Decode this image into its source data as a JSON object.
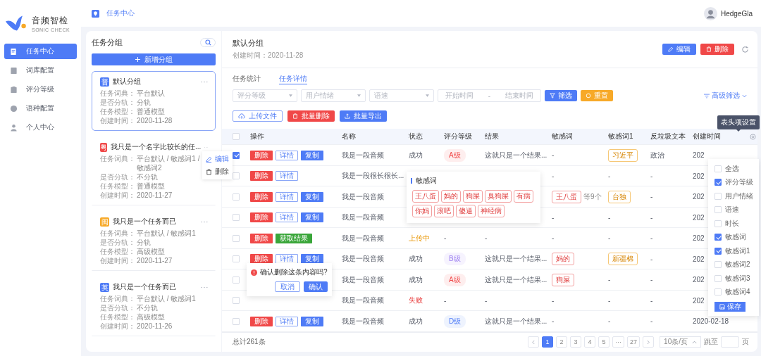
{
  "sidebar": {
    "logo": {
      "name": "音频智检",
      "subtitle": "SONIC CHECK"
    },
    "items": [
      {
        "label": "任务中心",
        "selected": true
      },
      {
        "label": "词库配置",
        "selected": false
      },
      {
        "label": "评分等级",
        "selected": false
      },
      {
        "label": "语种配置",
        "selected": false
      },
      {
        "label": "个人中心",
        "selected": false
      }
    ]
  },
  "topbar": {
    "breadcrumb": "任务中心",
    "user": "HedgeGla"
  },
  "groups": {
    "title": "任务分组",
    "add_button": "新增分组",
    "items": [
      {
        "badge": "普",
        "color": "#4e7bf6",
        "title": "默认分组",
        "selected": true,
        "fields": [
          {
            "label": "任务词典：",
            "value": "平台默认"
          },
          {
            "label": "是否分轨：",
            "value": "分轨"
          },
          {
            "label": "任务模型：",
            "value": "普通模型"
          },
          {
            "label": "创建时间：",
            "value": "2020-11-28"
          }
        ]
      },
      {
        "badge": "粤",
        "color": "#f04848",
        "title": "我只是一个名字比较长的任...",
        "selected": false,
        "fields": [
          {
            "label": "任务词典：",
            "value": "平台默认 / 敏感词1 / 敏感词2"
          },
          {
            "label": "是否分轨：",
            "value": "不分轨"
          },
          {
            "label": "任务模型：",
            "value": "普通模型"
          },
          {
            "label": "创建时间：",
            "value": "2020-11-27"
          }
        ],
        "menu": [
          {
            "label": "编辑",
            "selected": true
          },
          {
            "label": "删除",
            "selected": false
          }
        ]
      },
      {
        "badge": "闽",
        "color": "#f7a928",
        "title": "我只是一个任务而已",
        "selected": false,
        "fields": [
          {
            "label": "任务词典：",
            "value": "平台默认 / 敏感词1"
          },
          {
            "label": "是否分轨：",
            "value": "分轨"
          },
          {
            "label": "任务模型：",
            "value": "高级模型"
          },
          {
            "label": "创建时间：",
            "value": "2020-11-27"
          }
        ]
      },
      {
        "badge": "英",
        "color": "#4e7bf6",
        "title": "我只是一个任务而已",
        "selected": false,
        "fields": [
          {
            "label": "任务词典：",
            "value": "平台默认 / 敏感词1"
          },
          {
            "label": "是否分轨：",
            "value": "不分轨"
          },
          {
            "label": "任务模型：",
            "value": "高级模型"
          },
          {
            "label": "创建时间：",
            "value": "2020-11-26"
          }
        ]
      }
    ]
  },
  "main": {
    "title": "默认分组",
    "subtitle": "创建时间：2020-11-28",
    "edit_button": "编辑",
    "delete_button": "删除",
    "tabs": [
      {
        "label": "任务统计",
        "selected": false
      },
      {
        "label": "任务详情",
        "selected": true
      }
    ],
    "filters": {
      "selects": [
        {
          "placeholder": "评分等级"
        },
        {
          "placeholder": "用户情绪"
        },
        {
          "placeholder": "语速"
        }
      ],
      "date_start": "开始时间",
      "date_sep": "-",
      "date_end": "结束时间",
      "filter_button": "筛选",
      "reset_button": "重置",
      "advanced": "高级筛选"
    },
    "toolbar": {
      "upload": "上传文件",
      "batch_delete": "批量删除",
      "batch_export": "批量导出"
    },
    "table": {
      "select_all_checked": false,
      "columns": [
        "操作",
        "名称",
        "状态",
        "评分等级",
        "结果",
        "敏感词",
        "敏感词1",
        "反垃圾文本",
        "创建时间"
      ],
      "rows": [
        {
          "checked": true,
          "actions": [
            {
              "label": "删除",
              "kind": "danger"
            },
            {
              "label": "详情",
              "kind": "outline"
            },
            {
              "label": "复制",
              "kind": "primary"
            }
          ],
          "name": "我是一段音频",
          "status": {
            "label": "成功",
            "kind": "success"
          },
          "grade": {
            "kind": "tag",
            "label": "A级",
            "color": "#f04848"
          },
          "result": "这就只是一个结果...",
          "sensitive": {
            "kind": "text",
            "label": "-"
          },
          "sensitive1": {
            "kind": "tag",
            "label": "习近平"
          },
          "spam": "政治",
          "created": "202"
        },
        {
          "checked": false,
          "actions": [
            {
              "label": "删除",
              "kind": "danger"
            },
            {
              "label": "详情",
              "kind": "outline"
            }
          ],
          "name": "我是一段很长很长...",
          "sensitive": {
            "kind": "text",
            "label": "-"
          },
          "sensitive1": {
            "kind": "text",
            "label": "-"
          },
          "spam": "-",
          "created": "202"
        },
        {
          "checked": false,
          "actions": [
            {
              "label": "删除",
              "kind": "danger"
            },
            {
              "label": "详情",
              "kind": "outline"
            },
            {
              "label": "复制",
              "kind": "primary"
            }
          ],
          "name": "我是一段音频",
          "sensitive": {
            "kind": "tag",
            "label": "王八蛋",
            "extra": "等9个"
          },
          "sensitive1": {
            "kind": "tag",
            "label": "台独"
          },
          "spam": "-",
          "created": "202"
        },
        {
          "checked": false,
          "actions": [
            {
              "label": "删除",
              "kind": "danger"
            },
            {
              "label": "详情",
              "kind": "outline"
            },
            {
              "label": "复制",
              "kind": "primary"
            }
          ],
          "name": "我是一段音频",
          "sensitive": {
            "kind": "text",
            "label": "-"
          },
          "sensitive1": {
            "kind": "text",
            "label": "-"
          },
          "spam": "-",
          "created": "202"
        },
        {
          "checked": false,
          "actions": [
            {
              "label": "删除",
              "kind": "danger"
            },
            {
              "label": "获取结果",
              "kind": "success"
            }
          ],
          "name": "我是一段音频",
          "status": {
            "label": "上传中",
            "kind": "uploading"
          },
          "grade": {
            "kind": "text",
            "label": "-"
          },
          "result": "-",
          "sensitive": {
            "kind": "text",
            "label": "-"
          },
          "sensitive1": {
            "kind": "text",
            "label": "-"
          },
          "spam": "-",
          "created": "202"
        },
        {
          "checked": false,
          "actions": [
            {
              "label": "删除",
              "kind": "danger"
            },
            {
              "label": "详情",
              "kind": "outline"
            },
            {
              "label": "复制",
              "kind": "primary"
            }
          ],
          "name": "我是一段音频",
          "status": {
            "label": "成功",
            "kind": "success"
          },
          "grade": {
            "kind": "tag",
            "label": "B级",
            "color": "#9b7ef0"
          },
          "result": "这就只是一个结果...",
          "sensitive": {
            "kind": "tag",
            "label": "妈的"
          },
          "sensitive1": {
            "kind": "tag",
            "label": "新疆棉"
          },
          "spam": "-",
          "created": "202"
        },
        {
          "checked": false,
          "actions": [],
          "name": "我是一段音频",
          "status": {
            "label": "成功",
            "kind": "success"
          },
          "grade": {
            "kind": "tag",
            "label": "A级",
            "color": "#f04848"
          },
          "result": "这就只是一个结果...",
          "sensitive": {
            "kind": "tag",
            "label": "狗屎"
          },
          "sensitive1": {
            "kind": "text",
            "label": "-"
          },
          "spam": "-",
          "created": "202"
        },
        {
          "checked": false,
          "actions": [],
          "name": "我是一段音频",
          "status": {
            "label": "失败",
            "kind": "failed"
          },
          "grade": {
            "kind": "text",
            "label": "-"
          },
          "result": "-",
          "sensitive": {
            "kind": "text",
            "label": "-"
          },
          "sensitive1": {
            "kind": "text",
            "label": "-"
          },
          "spam": "-",
          "created": "202"
        },
        {
          "checked": false,
          "actions": [
            {
              "label": "删除",
              "kind": "danger"
            },
            {
              "label": "详情",
              "kind": "outline"
            },
            {
              "label": "复制",
              "kind": "primary"
            }
          ],
          "name": "我是一段音频",
          "status": {
            "label": "成功",
            "kind": "success"
          },
          "grade": {
            "kind": "tag",
            "label": "D级",
            "color": "#4e7bf6"
          },
          "result": "这就只是一个结果...",
          "sensitive": {
            "kind": "text",
            "label": "-"
          },
          "sensitive1": {
            "kind": "text",
            "label": "-"
          },
          "spam": "-",
          "created": "2020-02-18"
        }
      ]
    },
    "pagination": {
      "total": "总计261条",
      "pages": [
        {
          "label": "1",
          "selected": true
        },
        {
          "label": "2",
          "selected": false
        },
        {
          "label": "3",
          "selected": false
        },
        {
          "label": "4",
          "selected": false
        },
        {
          "label": "5",
          "selected": false
        },
        {
          "label": "···",
          "selected": false
        },
        {
          "label": "27",
          "selected": false
        }
      ],
      "page_size": "10条/页",
      "jump_label": "跳至",
      "jump_suffix": "页"
    }
  },
  "sensitive_popover": {
    "title": "敏感词",
    "tags": [
      "王八蛋",
      "妈的",
      "狗屎",
      "臭狗屎",
      "有病",
      "你妈",
      "滚吧",
      "傻逼",
      "神经病"
    ]
  },
  "confirm_popover": {
    "message": "确认删除这条内容吗?",
    "cancel": "取消",
    "ok": "确认"
  },
  "column_settings": {
    "tooltip": "表头项设置",
    "options": [
      {
        "label": "全选",
        "checked": false
      },
      {
        "label": "评分等级",
        "checked": true
      },
      {
        "label": "用户情绪",
        "checked": false
      },
      {
        "label": "语速",
        "checked": false
      },
      {
        "label": "时长",
        "checked": false
      },
      {
        "label": "敏感词",
        "checked": true
      },
      {
        "label": "敏感词1",
        "checked": true
      },
      {
        "label": "敏感词2",
        "checked": false
      },
      {
        "label": "敏感词3",
        "checked": false
      },
      {
        "label": "敏感词4",
        "checked": false
      }
    ],
    "save": "保存"
  }
}
